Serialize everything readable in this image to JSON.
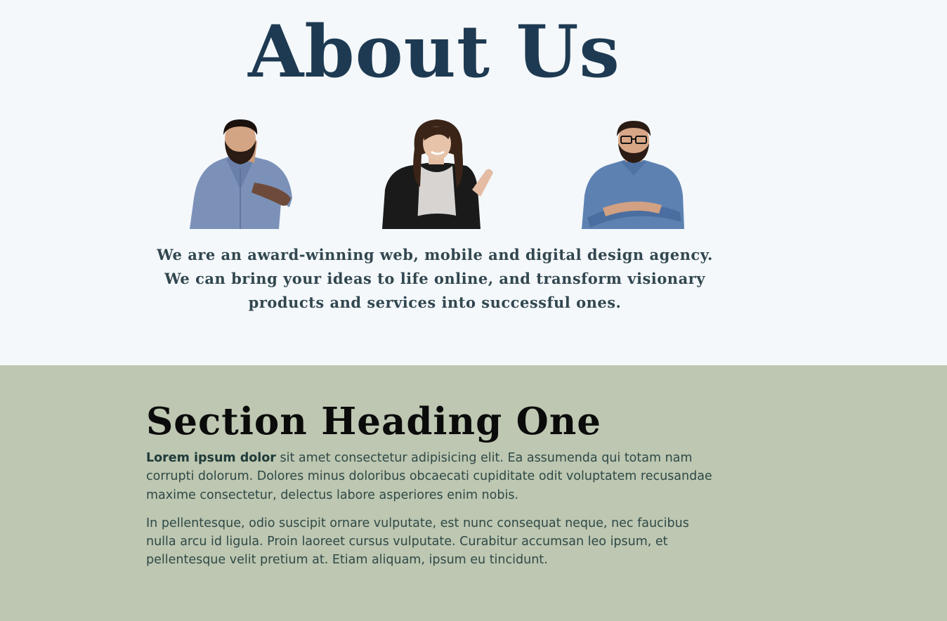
{
  "about": {
    "title": "About Us",
    "team": [
      {
        "name": "man-beard-thinking",
        "shirt": "#7b91b8"
      },
      {
        "name": "woman-smiling",
        "shirt": "#1a1a1a"
      },
      {
        "name": "man-glasses-arms-crossed",
        "shirt": "#5d82b2"
      }
    ],
    "intro": "We are an award-winning web, mobile and digital design agency. We can bring your ideas to life online, and transform visionary products and services into successful ones."
  },
  "section": {
    "heading": "Section Heading One",
    "p1_bold": "Lorem ipsum dolor",
    "p1_rest": " sit amet consectetur adipisicing elit. Ea assumenda qui totam nam corrupti dolorum. Dolores minus doloribus obcaecati cupiditate odit voluptatem recusandae maxime consectetur, delectus labore asperiores enim nobis.",
    "p2": "In pellentesque, odio suscipit ornare vulputate, est nunc consequat neque, nec faucibus nulla arcu id ligula. Proin laoreet cursus vulputate. Curabitur accumsan leo ipsum, et pellentesque velit pretium at. Etiam aliquam, ipsum eu tincidunt."
  },
  "colors": {
    "about_bg": "#f4f8fb",
    "title": "#1e3a52",
    "section_bg": "#bdc7b1",
    "body_text": "#2f4947"
  }
}
